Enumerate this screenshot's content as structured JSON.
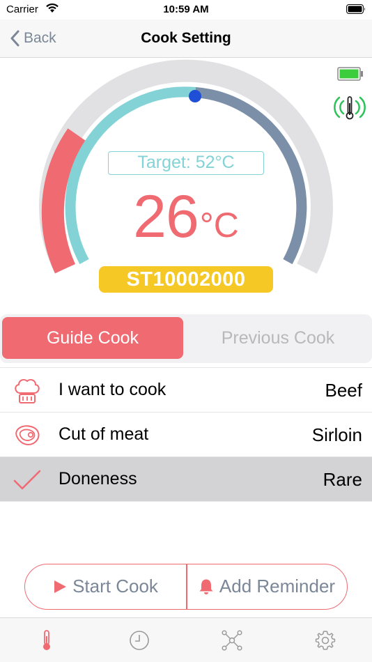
{
  "status_bar": {
    "carrier": "Carrier",
    "time": "10:59 AM"
  },
  "nav": {
    "back_label": "Back",
    "title": "Cook Setting"
  },
  "gauge": {
    "target_label": "Target: 52°C",
    "current_temp": "26",
    "temp_unit": "°C",
    "device_id": "ST10002000",
    "progress_fraction": 0.5,
    "icons": [
      "battery-full-icon",
      "probe-signal-icon"
    ]
  },
  "segment": {
    "active_label": "Guide Cook",
    "inactive_label": "Previous Cook"
  },
  "list": [
    {
      "icon": "chef-hat-icon",
      "label": "I want to cook",
      "value": "Beef",
      "selected": false
    },
    {
      "icon": "steak-icon",
      "label": "Cut of meat",
      "value": "Sirloin",
      "selected": false
    },
    {
      "icon": "checkmark-icon",
      "label": "Doneness",
      "value": "Rare",
      "selected": true
    }
  ],
  "actions": {
    "start_label": "Start Cook",
    "reminder_label": "Add Reminder"
  },
  "tabs": [
    "thermometer-icon",
    "clock-icon",
    "network-icon",
    "gear-icon"
  ],
  "colors": {
    "accent": "#f06a72",
    "teal": "#83d3d6",
    "slate": "#7b8fa8",
    "badge": "#f5c825",
    "signal": "#2fc25b",
    "grey_text": "#7b8797"
  }
}
